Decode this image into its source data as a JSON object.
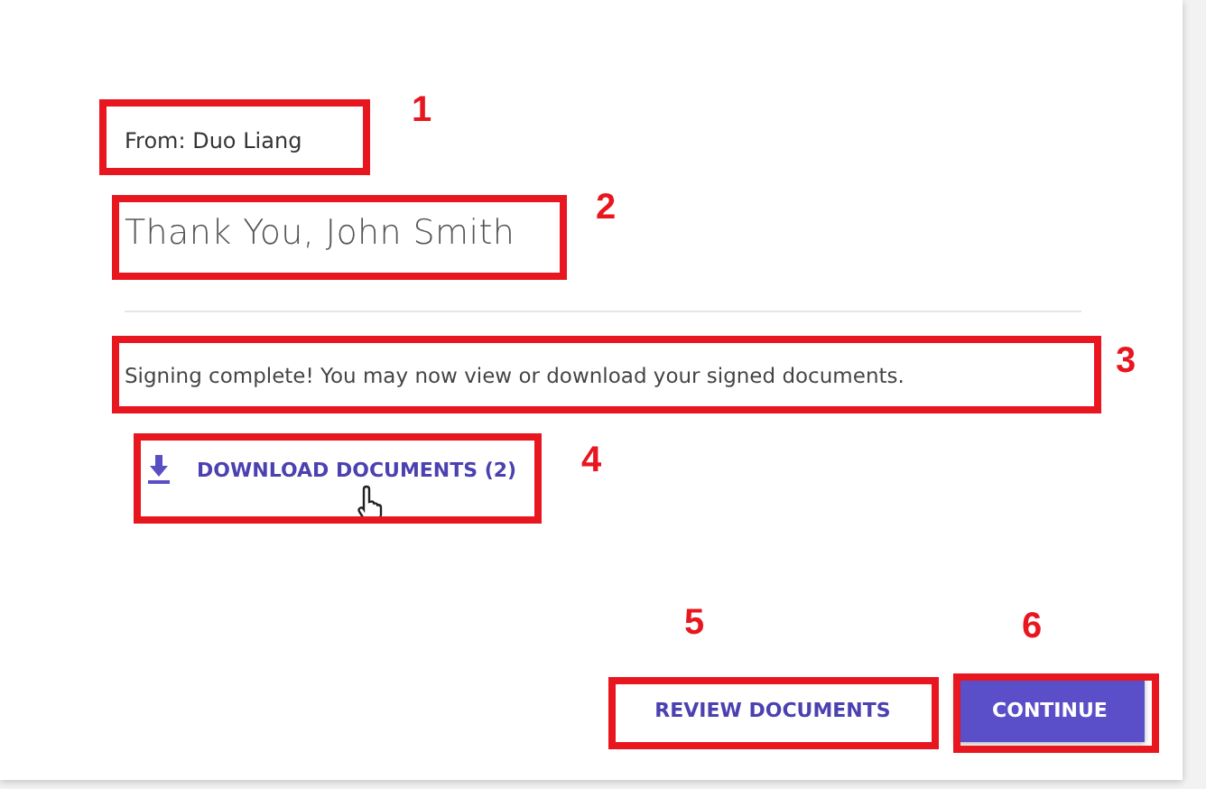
{
  "sender": "From: Duo Liang",
  "heading": "Thank You, John Smith",
  "message": "Signing complete! You may now view or download your signed documents.",
  "download_link": "DOWNLOAD DOCUMENTS (2)",
  "buttons": [
    {
      "label": "REVIEW DOCUMENTS",
      "kind": "secondary"
    },
    {
      "label": "CONTINUE",
      "kind": "primary"
    }
  ],
  "annotations": [
    {
      "number": "1"
    },
    {
      "number": "2"
    },
    {
      "number": "3"
    },
    {
      "number": "4"
    },
    {
      "number": "5"
    },
    {
      "number": "6"
    }
  ]
}
